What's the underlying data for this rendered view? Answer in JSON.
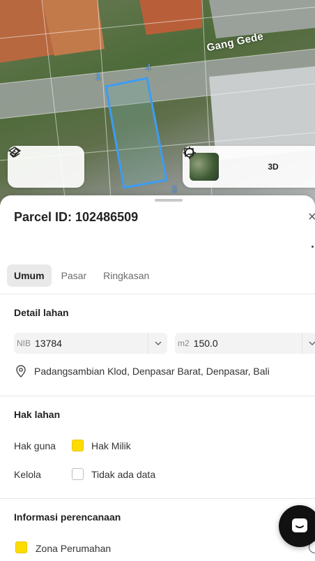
{
  "map": {
    "road_label": "Gang Gede",
    "vertices": [
      "1",
      "4",
      "3"
    ],
    "controls_left": [
      {
        "icon": "layers-icon"
      },
      {
        "icon": "measure-icon"
      }
    ],
    "controls_right": [
      {
        "icon": "satellite-thumbnail"
      },
      {
        "icon": "crosshair-icon"
      },
      {
        "label": "3D"
      },
      {
        "icon": "feedback-icon"
      }
    ]
  },
  "sheet": {
    "title": "Parcel ID: 102486509",
    "close_label": "×",
    "tabs": [
      {
        "label": "Umum",
        "active": true
      },
      {
        "label": "Pasar",
        "active": false
      },
      {
        "label": "Ringkasan",
        "active": false
      }
    ],
    "detail": {
      "title": "Detail lahan",
      "nib_prefix": "NIB",
      "nib_value": "13784",
      "area_prefix": "m2",
      "area_value": "150.0",
      "address": "Padangsambian Klod, Denpasar Barat, Denpasar, Bali"
    },
    "hak": {
      "title": "Hak lahan",
      "rows": [
        {
          "label": "Hak guna",
          "value": "Hak Milik",
          "color": "#ffdc00"
        },
        {
          "label": "Kelola",
          "value": "Tidak ada data",
          "color": "#ffffff"
        }
      ]
    },
    "planning": {
      "title": "Informasi perencanaan",
      "zone_label": "Zona Perumahan",
      "zone_color": "#ffdc00"
    }
  },
  "colors": {
    "accent_parcel": "#4fa3ff",
    "zone_yellow": "#ffdc00",
    "tab_active_bg": "#e9e9e9"
  }
}
